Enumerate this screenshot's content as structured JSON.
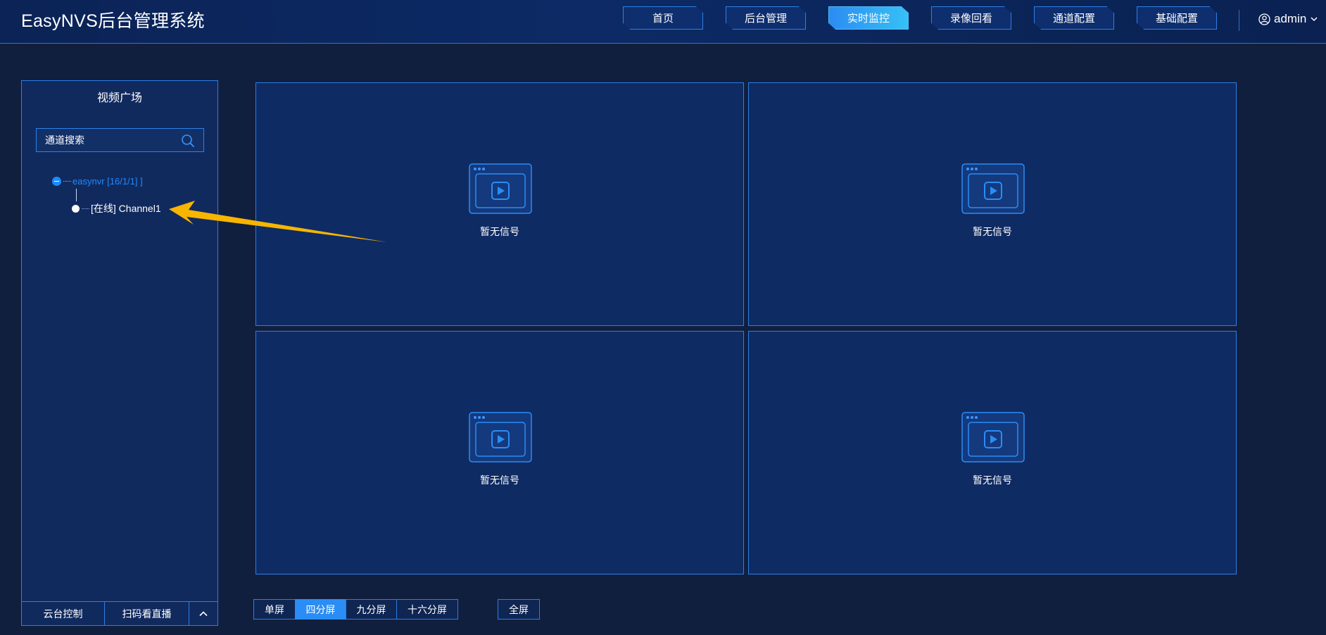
{
  "header": {
    "app_title": "EasyNVS后台管理系统",
    "nav_tabs": [
      {
        "label": "首页",
        "active": false
      },
      {
        "label": "后台管理",
        "active": false
      },
      {
        "label": "实时监控",
        "active": true
      },
      {
        "label": "录像回看",
        "active": false
      },
      {
        "label": "通道配置",
        "active": false
      },
      {
        "label": "基础配置",
        "active": false
      }
    ],
    "user": {
      "name": "admin",
      "icon": "user-circle-icon",
      "dropdown_icon": "chevron-down-icon"
    }
  },
  "sidebar": {
    "title": "视频广场",
    "search": {
      "placeholder": "通道搜索",
      "value": "",
      "icon": "search-icon"
    },
    "tree": {
      "root": {
        "label": "easynvr [16/1/1] ]",
        "expanded": true
      },
      "children": [
        {
          "label": "[在线] Channel1",
          "status": "online"
        }
      ]
    },
    "footer": {
      "ptz_label": "云台控制",
      "scan_label": "扫码看直播",
      "collapse_icon": "chevron-up-icon"
    }
  },
  "video_grid": {
    "cells": [
      {
        "status_text": "暂无信号"
      },
      {
        "status_text": "暂无信号"
      },
      {
        "status_text": "暂无信号"
      },
      {
        "status_text": "暂无信号"
      }
    ]
  },
  "layout_bar": {
    "options": [
      {
        "label": "单屏",
        "active": false
      },
      {
        "label": "四分屏",
        "active": true
      },
      {
        "label": "九分屏",
        "active": false
      },
      {
        "label": "十六分屏",
        "active": false
      }
    ],
    "fullscreen_label": "全屏"
  },
  "colors": {
    "background": "#111f3f",
    "accent": "#2a8df5",
    "panel_border": "#2a7ee8",
    "annotation_arrow": "#f7b500"
  }
}
